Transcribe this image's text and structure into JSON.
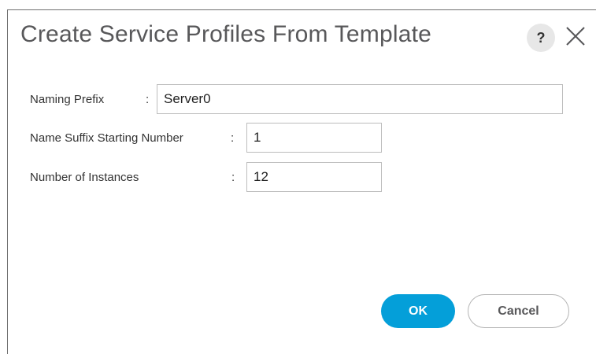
{
  "dialog": {
    "title": "Create Service Profiles From Template",
    "help_icon": "help-icon",
    "help_glyph": "?",
    "close_icon": "close-icon"
  },
  "form": {
    "naming_prefix": {
      "label": "Naming Prefix",
      "colon": ":",
      "value": "Server0"
    },
    "name_suffix_start": {
      "label": "Name Suffix Starting Number",
      "colon": ":",
      "value": "1"
    },
    "number_of_instances": {
      "label": "Number of Instances",
      "colon": ":",
      "value": "12"
    }
  },
  "buttons": {
    "ok_label": "OK",
    "cancel_label": "Cancel"
  },
  "colors": {
    "primary": "#049fd9",
    "title_text": "#58585a",
    "border": "#bdbdbd"
  }
}
